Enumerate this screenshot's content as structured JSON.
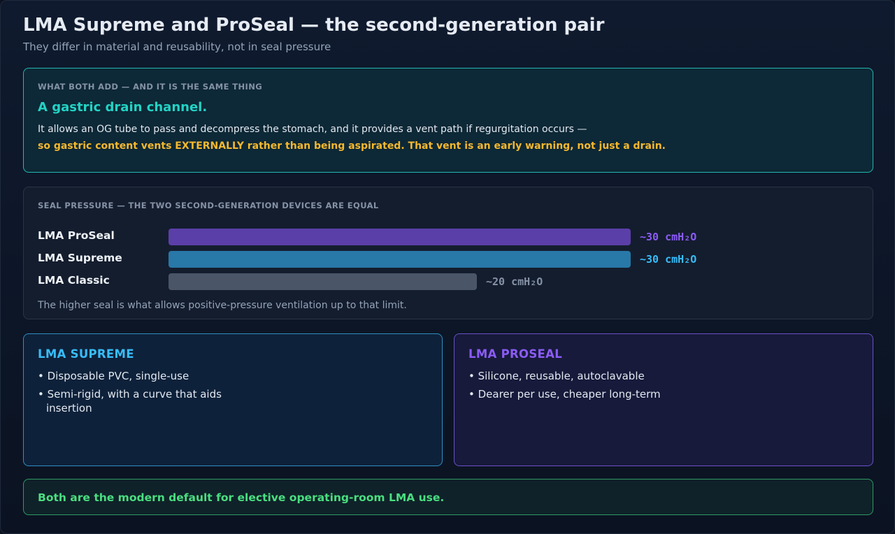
{
  "header": {
    "title": "LMA Supreme and ProSeal — the second-generation pair",
    "subtitle": "They differ in material and reusability, not in seal pressure"
  },
  "drain": {
    "label": "WHAT BOTH ADD — AND IT IS THE SAME THING",
    "heading": "A gastric drain channel.",
    "body": "It allows an OG tube to pass and decompress the stomach, and it provides a vent path if regurgitation occurs —",
    "warning": "so gastric content vents EXTERNALLY rather than being aspirated. That vent is an early warning, not just a drain."
  },
  "seal": {
    "label": "SEAL PRESSURE — THE TWO SECOND-GENERATION DEVICES ARE EQUAL",
    "note": "The higher seal is what allows positive-pressure ventilation up to that limit."
  },
  "chart_data": {
    "type": "bar",
    "orientation": "horizontal",
    "categories": [
      "LMA ProSeal",
      "LMA Supreme",
      "LMA Classic"
    ],
    "values": [
      30,
      30,
      20
    ],
    "value_labels": [
      "~30 cmH₂O",
      "~30 cmH₂O",
      "~20 cmH₂O"
    ],
    "xlim": [
      0,
      30
    ],
    "colors": [
      "#5b3fa8",
      "#2878a8",
      "#4a5568"
    ],
    "label_colors": [
      "#8b5cf6",
      "#38bdf8",
      "#8592a6"
    ]
  },
  "supreme": {
    "heading": "LMA SUPREME",
    "items": [
      "• Disposable PVC, single-use",
      "• Semi-rigid, with a curve that aids insertion"
    ],
    "accent": "#38bdf8"
  },
  "proseal": {
    "heading": "LMA PROSEAL",
    "items": [
      "• Silicone, reusable, autoclavable",
      "• Dearer per use, cheaper long-term"
    ],
    "accent": "#8b5cf6"
  },
  "footer": {
    "text": "Both are the modern default for elective operating-room LMA use."
  }
}
